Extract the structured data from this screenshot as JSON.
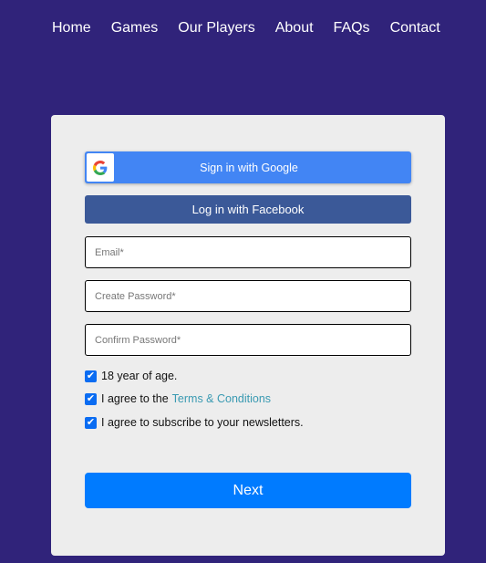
{
  "nav": {
    "items": [
      {
        "label": "Home"
      },
      {
        "label": "Games"
      },
      {
        "label": "Our Players"
      },
      {
        "label": "About"
      },
      {
        "label": "FAQs"
      },
      {
        "label": "Contact"
      }
    ]
  },
  "form": {
    "google_label": "Sign in with Google",
    "google_icon": "google-g-icon",
    "facebook_label": "Log in with Facebook",
    "fields": [
      {
        "placeholder": "Email*",
        "value": ""
      },
      {
        "placeholder": "Create Password*",
        "value": ""
      },
      {
        "placeholder": "Confirm Password*",
        "value": ""
      }
    ],
    "checks": [
      {
        "label": "18 year of age.",
        "checked": true
      },
      {
        "label": "I agree to the",
        "link": "Terms & Conditions",
        "checked": true
      },
      {
        "label": "I agree to subscribe to your newsletters.",
        "checked": true
      }
    ],
    "next_label": "Next"
  },
  "colors": {
    "background": "#30237a",
    "card": "#ededed",
    "google": "#4285f4",
    "facebook": "#3b5998",
    "primary": "#007bff",
    "link": "#3a9ab2"
  }
}
